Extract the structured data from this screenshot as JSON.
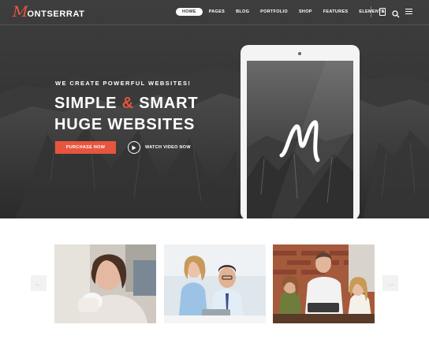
{
  "logo": {
    "initial": "M",
    "text": "ONTSERRAT"
  },
  "nav": {
    "items": [
      {
        "label": "HOME",
        "active": true
      },
      {
        "label": "PAGES"
      },
      {
        "label": "BLOG"
      },
      {
        "label": "PORTFOLIO"
      },
      {
        "label": "SHOP"
      },
      {
        "label": "FEATURES"
      },
      {
        "label": "ELEMENTS"
      }
    ],
    "cart_count": "0"
  },
  "hero": {
    "tagline": "WE CREATE POWERFUL WEBSITES!",
    "headline_line1_a": "SIMPLE ",
    "headline_line1_amp": "&",
    "headline_line1_b": " SMART",
    "headline_line2": "HUGE WEBSITES",
    "purchase_label": "PURCHASE NOW",
    "watch_label": "WATCH VIDEO NOW"
  },
  "icons": {
    "cart": "shopping-bag-icon",
    "search": "search-icon",
    "menu": "hamburger-menu-icon",
    "play": "play-icon",
    "prev": "arrow-left-icon",
    "next": "arrow-right-icon"
  },
  "colors": {
    "accent": "#e8553e",
    "hero_bg": "#2e2e2e"
  },
  "carousel": {
    "prev_glyph": "←",
    "next_glyph": "→"
  }
}
